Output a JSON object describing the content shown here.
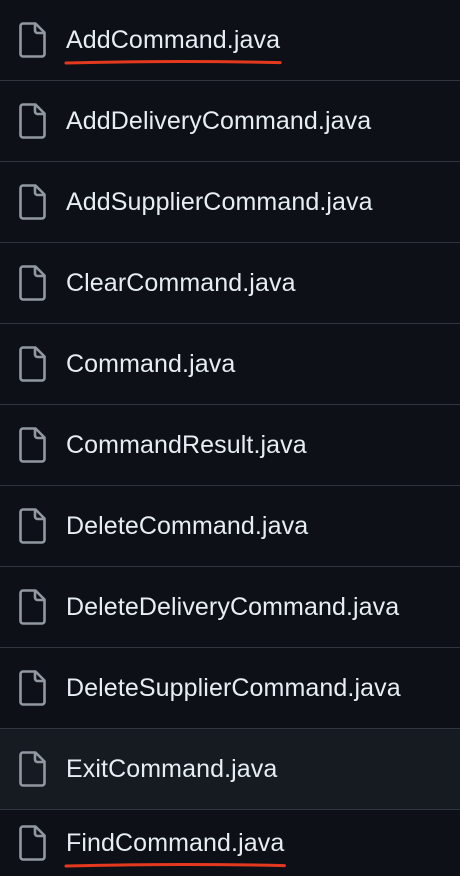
{
  "files": [
    {
      "name": "AddCommand.java",
      "icon": "file-icon",
      "underlined": true
    },
    {
      "name": "AddDeliveryCommand.java",
      "icon": "file-icon"
    },
    {
      "name": "AddSupplierCommand.java",
      "icon": "file-icon"
    },
    {
      "name": "ClearCommand.java",
      "icon": "file-icon"
    },
    {
      "name": "Command.java",
      "icon": "file-icon"
    },
    {
      "name": "CommandResult.java",
      "icon": "file-icon"
    },
    {
      "name": "DeleteCommand.java",
      "icon": "file-icon"
    },
    {
      "name": "DeleteDeliveryCommand.java",
      "icon": "file-icon"
    },
    {
      "name": "DeleteSupplierCommand.java",
      "icon": "file-icon"
    },
    {
      "name": "ExitCommand.java",
      "icon": "file-icon",
      "hovered": true
    },
    {
      "name": "FindCommand.java",
      "icon": "file-icon",
      "underlined": true
    }
  ],
  "colors": {
    "background": "#0d1117",
    "row_hover": "#161b22",
    "divider": "#30363d",
    "text": "#e6edf3",
    "icon": "#9198a1",
    "annotation": "#e5391f"
  }
}
